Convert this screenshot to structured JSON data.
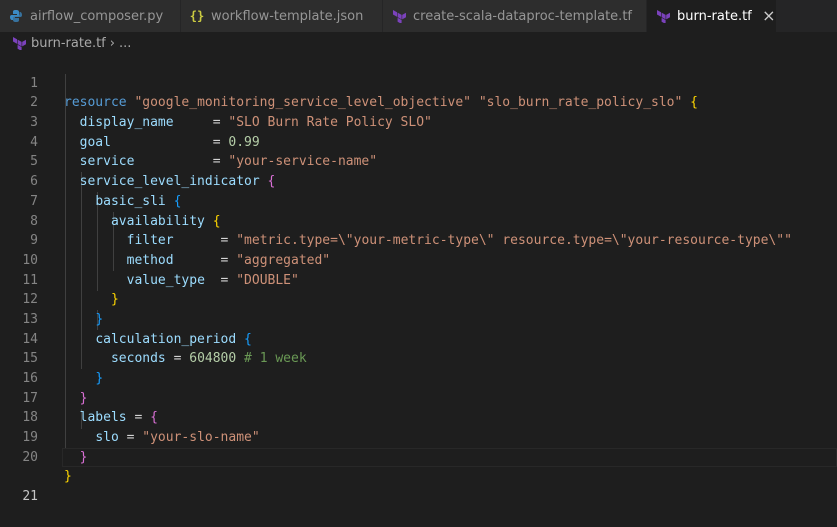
{
  "tabs": [
    {
      "label": "airflow_composer.py",
      "icon": "python-icon",
      "active": false
    },
    {
      "label": "workflow-template.json",
      "icon": "json-braces-icon",
      "active": false
    },
    {
      "label": "create-scala-dataproc-template.tf",
      "icon": "terraform-icon",
      "active": false
    },
    {
      "label": "burn-rate.tf",
      "icon": "terraform-icon",
      "active": true,
      "close": "×"
    }
  ],
  "breadcrumb": {
    "file": "burn-rate.tf",
    "separator": "›",
    "more": "..."
  },
  "colors": {
    "keyword": "#569cd6",
    "string": "#ce9178",
    "attribute": "#9cdcfe",
    "number": "#b5cea8",
    "comment": "#6a9955",
    "bracket1": "#ffd700",
    "bracket2": "#da70d6",
    "bracket3": "#179fff",
    "terraform": "#7b42bc",
    "python": "#3b8ac4",
    "json": "#cbcb41"
  },
  "code": {
    "l1": {
      "ln": "1",
      "kw": "resource",
      "s1": "\"google_monitoring_service_level_objective\"",
      "s2": "\"slo_burn_rate_policy_slo\"",
      "br": "{"
    },
    "l2": {
      "ln": "2",
      "key": "display_name",
      "eq": "     = ",
      "val": "\"SLO Burn Rate Policy SLO\""
    },
    "l3": {
      "ln": "3",
      "key": "goal",
      "eq": "             = ",
      "val": "0.99"
    },
    "l4": {
      "ln": "4",
      "key": "service",
      "eq": "          = ",
      "val": "\"your-service-name\""
    },
    "l5": {
      "ln": "5",
      "key": "service_level_indicator",
      "br": "{"
    },
    "l6": {
      "ln": "6",
      "key": "basic_sli",
      "br": "{"
    },
    "l7": {
      "ln": "7",
      "key": "availability",
      "br": "{"
    },
    "l8": {
      "ln": "8",
      "key": "filter",
      "eq": "      = ",
      "val": "\"metric.type=\\\"your-metric-type\\\" resource.type=\\\"your-resource-type\\\"\""
    },
    "l9": {
      "ln": "9",
      "key": "method",
      "eq": "      = ",
      "val": "\"aggregated\""
    },
    "l10": {
      "ln": "10",
      "key": "value_type",
      "eq": "  = ",
      "val": "\"DOUBLE\""
    },
    "l11": {
      "ln": "11",
      "br": "}"
    },
    "l12": {
      "ln": "12",
      "br": "}"
    },
    "l13": {
      "ln": "13",
      "key": "calculation_period",
      "br": "{"
    },
    "l14": {
      "ln": "14",
      "key": "seconds",
      "eq": " = ",
      "val": "604800",
      "cmt": "# 1 week"
    },
    "l15": {
      "ln": "15",
      "br": "}"
    },
    "l16": {
      "ln": "16",
      "br": "}"
    },
    "l17": {
      "ln": "17",
      "key": "labels",
      "eq": " = ",
      "br": "{"
    },
    "l18": {
      "ln": "18",
      "key": "slo",
      "eq": " = ",
      "val": "\"your-slo-name\""
    },
    "l19": {
      "ln": "19",
      "br": "}"
    },
    "l20": {
      "ln": "20",
      "br": "}"
    },
    "l21": {
      "ln": "21"
    }
  }
}
